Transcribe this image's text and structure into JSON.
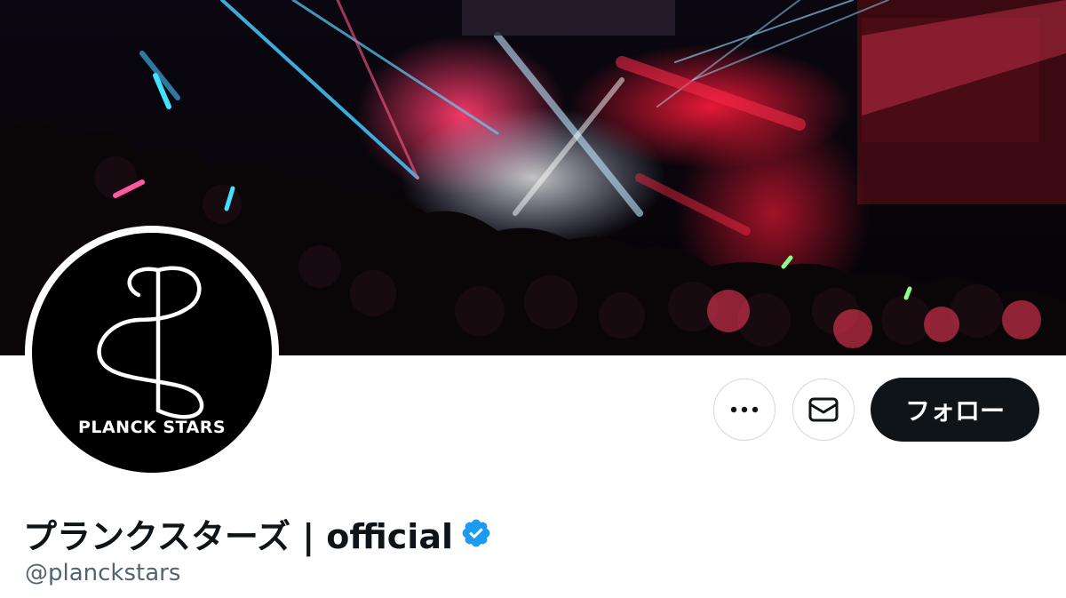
{
  "banner": {
    "description_icon": "concert-stage-photo"
  },
  "avatar": {
    "logo_text": "PLANCK STARS",
    "logo_icon": "ps-monogram-icon"
  },
  "actions": {
    "more_icon": "more-horizontal-icon",
    "message_icon": "envelope-icon",
    "follow_label": "フォロー"
  },
  "profile": {
    "display_name": "プランクスターズ | official",
    "verified_icon": "verified-badge-icon",
    "handle": "@planckstars"
  },
  "colors": {
    "follow_bg": "#0f1419",
    "verified": "#1d9bf0",
    "handle": "#536471",
    "border": "#cfd9de"
  }
}
